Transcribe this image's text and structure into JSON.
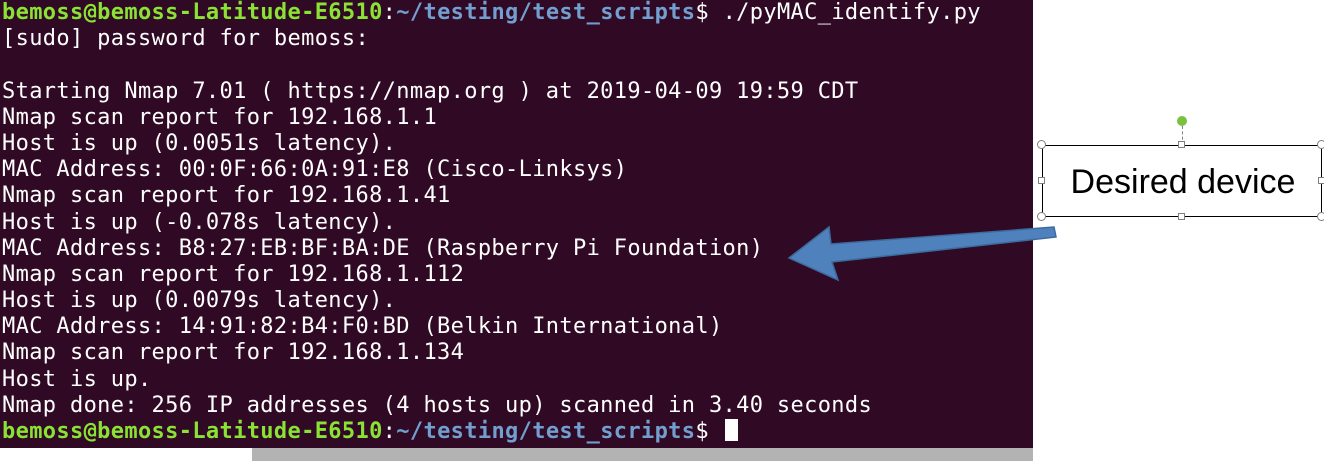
{
  "terminal": {
    "prompt_user": "bemoss@bemoss-Latitude-E6510",
    "prompt_sep": ":",
    "prompt_path": "~/testing/test_scripts",
    "prompt_symbol": "$ ",
    "command": "./pyMAC_identify.py",
    "output": [
      "[sudo] password for bemoss:",
      "",
      "Starting Nmap 7.01 ( https://nmap.org ) at 2019-04-09 19:59 CDT",
      "Nmap scan report for 192.168.1.1",
      "Host is up (0.0051s latency).",
      "MAC Address: 00:0F:66:0A:91:E8 (Cisco-Linksys)",
      "Nmap scan report for 192.168.1.41",
      "Host is up (-0.078s latency).",
      "MAC Address: B8:27:EB:BF:BA:DE (Raspberry Pi Foundation)",
      "Nmap scan report for 192.168.1.112",
      "Host is up (0.0079s latency).",
      "MAC Address: 14:91:82:B4:F0:BD (Belkin International)",
      "Nmap scan report for 192.168.1.134",
      "Host is up.",
      "Nmap done: 256 IP addresses (4 hosts up) scanned in 3.40 seconds"
    ]
  },
  "callout": {
    "label": "Desired device"
  },
  "colors": {
    "terminal_bg": "#300a24",
    "prompt_user": "#8ae234",
    "prompt_path": "#729fcf",
    "arrow": "#4a7ebb"
  }
}
